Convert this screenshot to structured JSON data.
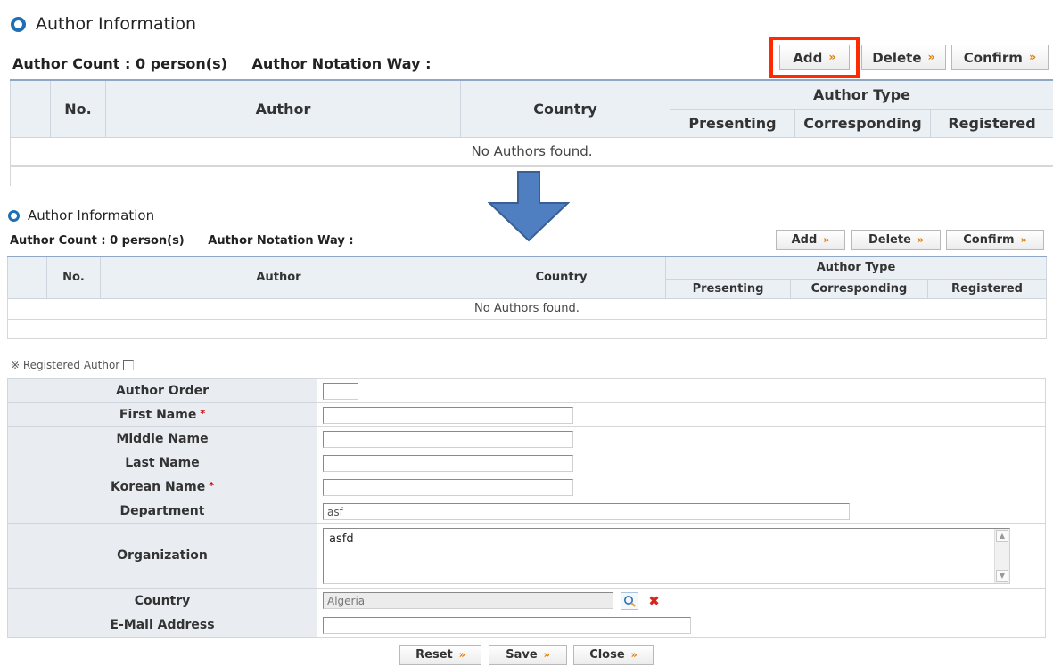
{
  "top_section": {
    "title": "Author Information",
    "author_count": "Author Count : 0 person(s)",
    "notation_way": "Author Notation Way :",
    "buttons": {
      "add": "Add",
      "delete": "Delete",
      "confirm": "Confirm"
    },
    "table": {
      "headers": {
        "no": "No.",
        "author": "Author",
        "country": "Country",
        "author_type": "Author Type",
        "presenting": "Presenting",
        "corresponding": "Corresponding",
        "registered": "Registered"
      },
      "empty_message": "No Authors found."
    }
  },
  "bottom_section": {
    "title": "Author Information",
    "author_count": "Author Count : 0 person(s)",
    "notation_way": "Author Notation Way :",
    "buttons": {
      "add": "Add",
      "delete": "Delete",
      "confirm": "Confirm"
    },
    "table": {
      "headers": {
        "no": "No.",
        "author": "Author",
        "country": "Country",
        "author_type": "Author Type",
        "presenting": "Presenting",
        "corresponding": "Corresponding",
        "registered": "Registered"
      },
      "empty_message": "No Authors found."
    }
  },
  "registered_author": {
    "label": "※ Registered Author",
    "checked": false
  },
  "form": {
    "author_order": {
      "label": "Author Order",
      "value": ""
    },
    "first_name": {
      "label": "First Name",
      "value": "",
      "required": true
    },
    "middle_name": {
      "label": "Middle Name",
      "value": ""
    },
    "last_name": {
      "label": "Last Name",
      "value": ""
    },
    "korean_name": {
      "label": "Korean Name",
      "value": "",
      "required": true
    },
    "department": {
      "label": "Department",
      "value": "asf"
    },
    "organization": {
      "label": "Organization",
      "value": "asfd"
    },
    "country": {
      "label": "Country",
      "value": "Algeria"
    },
    "email": {
      "label": "E-Mail Address",
      "value": ""
    },
    "required_mark": "*"
  },
  "footer_buttons": {
    "reset": "Reset",
    "save": "Save",
    "close": "Close"
  },
  "icons": {
    "arrow": "»",
    "search": "search-icon",
    "clear": "clear-icon",
    "section": "ring-bullet-icon"
  },
  "colors": {
    "highlight": "#ff2a00",
    "arrow_fill": "#4f7fc1",
    "accent_orange": "#e07b00",
    "header_bg": "#ebf0f5"
  }
}
